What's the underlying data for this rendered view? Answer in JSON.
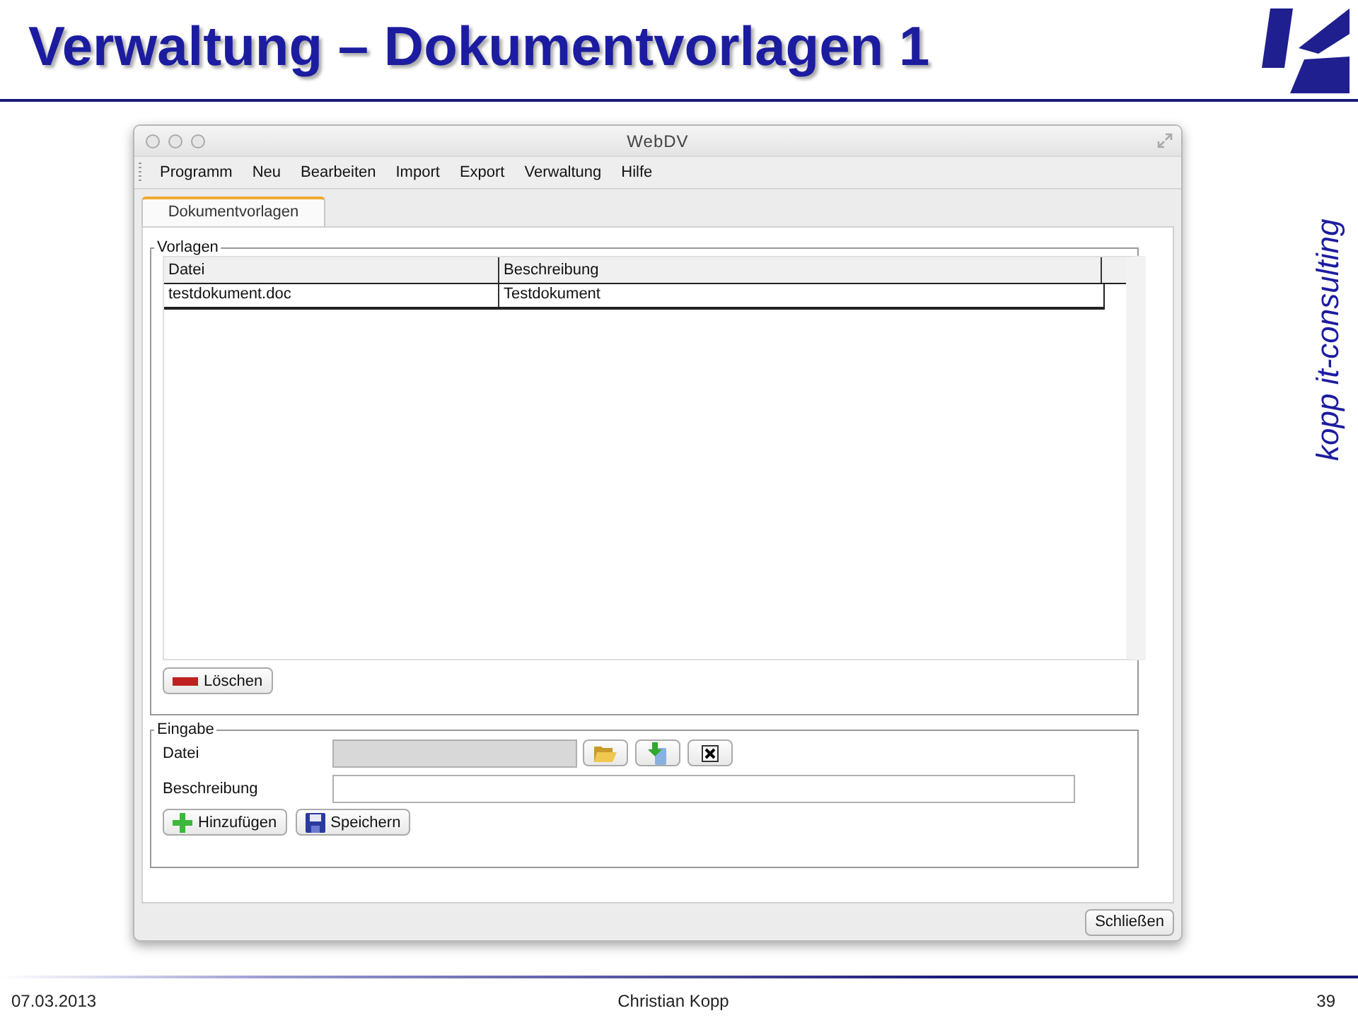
{
  "slide": {
    "title": "Verwaltung – Dokumentvorlagen 1",
    "brand": "kopp it-consulting"
  },
  "window": {
    "title": "WebDV"
  },
  "menu": [
    "Programm",
    "Neu",
    "Bearbeiten",
    "Import",
    "Export",
    "Verwaltung",
    "Hilfe"
  ],
  "tabs": [
    {
      "label": "Dokumentvorlagen",
      "selected": true
    }
  ],
  "vorlagen": {
    "legend": "Vorlagen",
    "columns": [
      "Datei",
      "Beschreibung"
    ],
    "rows": [
      {
        "cells": [
          "testdokument.doc",
          "Testdokument"
        ],
        "selected": true
      }
    ],
    "delete_button": "Löschen"
  },
  "eingabe": {
    "legend": "Eingabe",
    "fields": [
      {
        "kind": "file",
        "label": "Datei",
        "disabled": true
      },
      {
        "kind": "text",
        "label": "Beschreibung",
        "disabled": false
      }
    ],
    "buttons": [
      {
        "kind": "add",
        "label": "Hinzufügen"
      },
      {
        "kind": "save",
        "label": "Speichern"
      }
    ]
  },
  "close_button": "Schließen",
  "footer": {
    "date": "07.03.2013",
    "author": "Christian Kopp",
    "page": "39"
  }
}
